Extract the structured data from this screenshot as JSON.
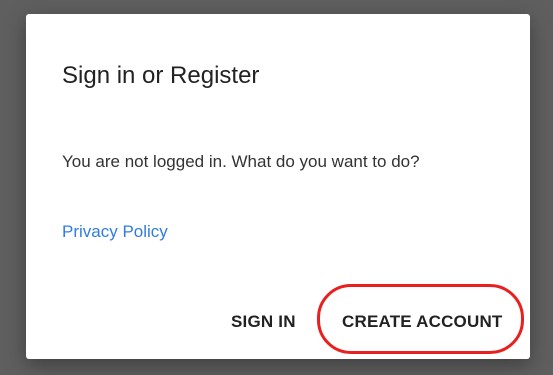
{
  "dialog": {
    "title": "Sign in or Register",
    "message": "You are not logged in. What do you want to do?",
    "privacy_link": "Privacy Policy",
    "buttons": {
      "sign_in": "SIGN IN",
      "create_account": "CREATE ACCOUNT"
    }
  },
  "colors": {
    "backdrop": "#5f5f5f",
    "dialog_background": "#ffffff",
    "link": "#2f7de1",
    "highlight": "#e8201f"
  }
}
